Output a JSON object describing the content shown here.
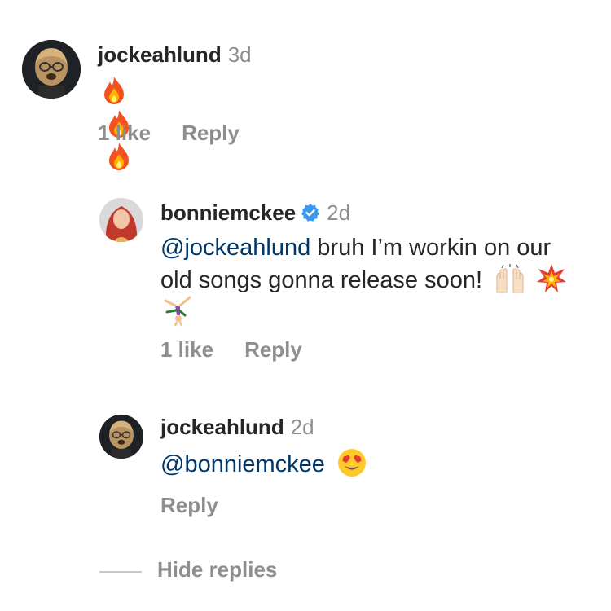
{
  "comments": [
    {
      "username": "jockeahlund",
      "time": "3d",
      "text_emoji": [
        "fire-emoji",
        "fire-emoji",
        "fire-emoji"
      ],
      "likes": "1 like",
      "reply": "Reply"
    },
    {
      "username": "bonniemckee",
      "verified": true,
      "time": "2d",
      "mention": "@jockeahlund",
      "text_line1": " bruh I’m workin on our",
      "text_line2": "old songs gonna release soon!",
      "text_emoji": [
        "raised-hands-emoji",
        "collision-emoji",
        "cartwheel-emoji"
      ],
      "likes": "1 like",
      "reply": "Reply"
    },
    {
      "username": "jockeahlund",
      "time": "2d",
      "mention": "@bonniemckee",
      "text_emoji": [
        "heart-eyes-emoji"
      ],
      "reply": "Reply"
    }
  ],
  "hide_replies": "Hide replies",
  "colors": {
    "text": "#262626",
    "secondary": "#8e8e8e",
    "mention": "#00376b",
    "verified": "#3897f0"
  }
}
